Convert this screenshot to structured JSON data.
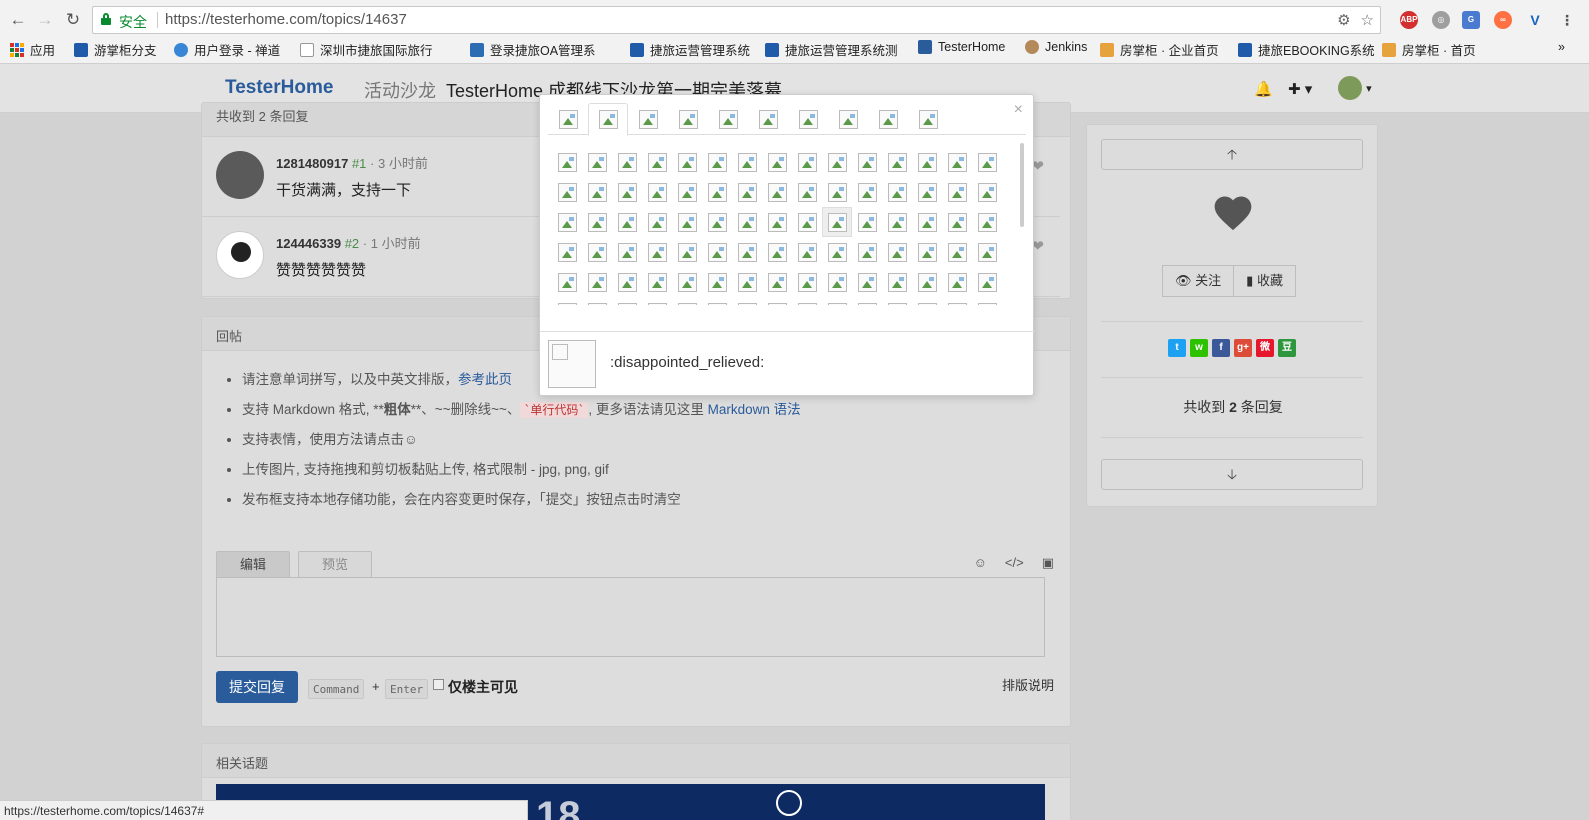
{
  "browser": {
    "security_label": "安全",
    "url": "https://testerhome.com/topics/14637",
    "bookmarks": [
      {
        "label": "应用",
        "icon": "apps-icon",
        "color": "#d93025"
      },
      {
        "label": "游掌柜分支",
        "icon": "bookmark-icon",
        "color": "#1f5ba8"
      },
      {
        "label": "用户登录 - 禅道",
        "icon": "globe-icon",
        "color": "#3a86d6"
      },
      {
        "label": "深圳市捷旅国际旅行",
        "icon": "page-icon",
        "color": "#999999"
      },
      {
        "label": "登录捷旅OA管理系",
        "icon": "bookmark-icon",
        "color": "#2b6cb3"
      },
      {
        "label": "捷旅运营管理系统",
        "icon": "bookmark-icon",
        "color": "#1f5ba8"
      },
      {
        "label": "捷旅运营管理系统测",
        "icon": "bookmark-icon",
        "color": "#1f5ba8"
      },
      {
        "label": "TesterHome",
        "icon": "shield-icon",
        "color": "#2a5b9b"
      },
      {
        "label": "Jenkins",
        "icon": "jenkins-icon",
        "color": "#b58a5a"
      },
      {
        "label": "房掌柜 · 企业首页",
        "icon": "bookmark-icon",
        "color": "#e6a23c"
      },
      {
        "label": "捷旅EBOOKING系统",
        "icon": "bookmark-icon",
        "color": "#1f5ba8"
      },
      {
        "label": "房掌柜 · 首页",
        "icon": "bookmark-icon",
        "color": "#e6a23c"
      }
    ],
    "more_bookmarks": "»",
    "status_url": "https://testerhome.com/topics/14637#"
  },
  "header": {
    "logo": "TesterHome",
    "node": "活动沙龙",
    "title": "TesterHome 成都线下沙龙第一期完美落幕"
  },
  "replies_panel": {
    "head": "共收到 2 条回复",
    "replies": [
      {
        "user": "1281480917",
        "floor": "#1",
        "time": "3 小时前",
        "body": "干货满满，支持一下"
      },
      {
        "user": "124446339",
        "floor": "#2",
        "time": "1 小时前",
        "body": "赞赞赞赞赞赞"
      }
    ]
  },
  "reply_form": {
    "head": "回帖",
    "tips": {
      "t1_prefix": "请注意单词拼写，以及中英文排版，",
      "t1_link": "参考此页",
      "t2_prefix": "支持 Markdown 格式, **",
      "t2_bold": "粗体",
      "t2_mid": "**、~~删除线~~、",
      "t2_code": "`单行代码`",
      "t2_after": ", 更多语法请见这里 ",
      "t2_link": "Markdown 语法",
      "t3": "支持表情，使用方法请点击☺",
      "t4": "上传图片, 支持拖拽和剪切板黏贴上传, 格式限制 - jpg, png, gif",
      "t5": "发布框支持本地存储功能，会在内容变更时保存，「提交」按钮点击时清空"
    },
    "tab_edit": "编辑",
    "tab_preview": "预览",
    "submit": "提交回复",
    "kbd_command": "Command",
    "kbd_plus": "+",
    "kbd_enter": "Enter",
    "owner_only": "仅楼主可见",
    "md_help": "排版说明"
  },
  "related": {
    "head": "相关话题",
    "banner_text": "18"
  },
  "sidebar": {
    "follow": "关注",
    "favorite": "收藏",
    "reply_count_prefix": "共收到 ",
    "reply_count": "2",
    "reply_count_suffix": " 条回复",
    "social": [
      {
        "name": "twitter",
        "color": "#1da1f2",
        "glyph": "t"
      },
      {
        "name": "wechat",
        "color": "#2dc100",
        "glyph": "w"
      },
      {
        "name": "facebook",
        "color": "#3b5998",
        "glyph": "f"
      },
      {
        "name": "google-plus",
        "color": "#dd4b39",
        "glyph": "g+"
      },
      {
        "name": "weibo",
        "color": "#e6162d",
        "glyph": "微"
      },
      {
        "name": "douban",
        "color": "#2e963d",
        "glyph": "豆"
      }
    ]
  },
  "emoji_popup": {
    "close": "×",
    "tabs": 10,
    "active_tab": 1,
    "columns": 15,
    "rows": 6,
    "hovered": {
      "row": 2,
      "col": 9
    },
    "preview_name": ":disappointed_relieved:"
  }
}
